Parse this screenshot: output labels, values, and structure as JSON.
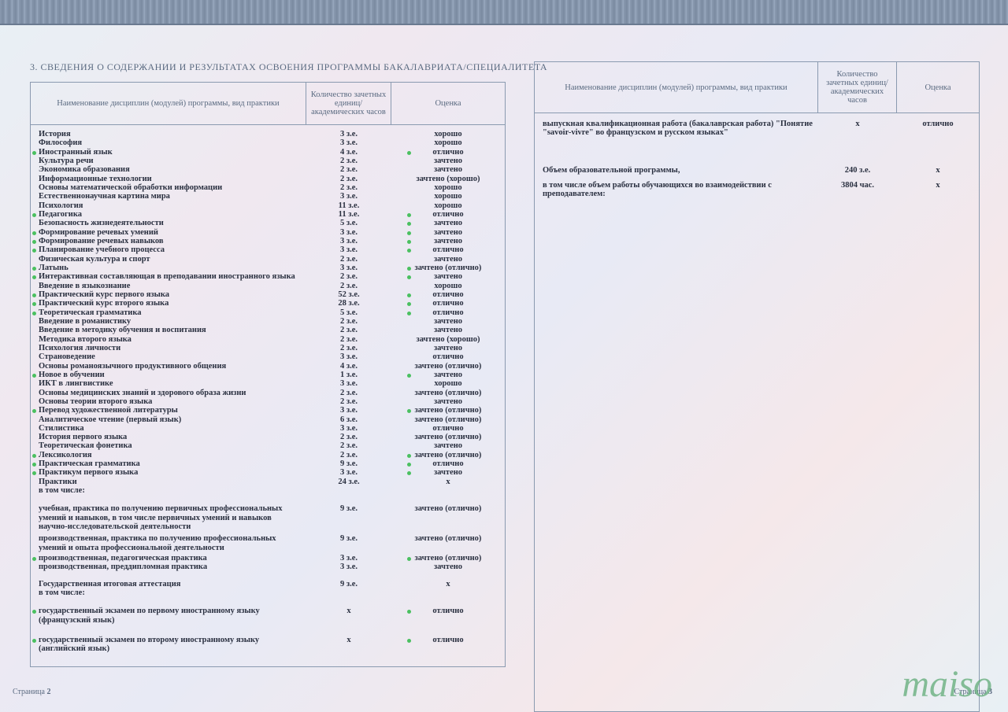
{
  "title": "3. СВЕДЕНИЯ О СОДЕРЖАНИИ И РЕЗУЛЬТАТАХ ОСВОЕНИЯ ПРОГРАММЫ БАКАЛАВРИАТА/СПЕЦИАЛИТЕТА",
  "headers": {
    "name": "Наименование дисциплин (модулей) программы, вид практики",
    "credits": "Количество зачетных единиц/ академических часов",
    "grade": "Оценка"
  },
  "left_rows": [
    {
      "name": "История",
      "credits": "3 з.е.",
      "grade": "хорошо",
      "dn": false,
      "dg": false
    },
    {
      "name": "Философия",
      "credits": "3 з.е.",
      "grade": "хорошо",
      "dn": false,
      "dg": false
    },
    {
      "name": "Иностранный язык",
      "credits": "4 з.е.",
      "grade": "отлично",
      "dn": true,
      "dg": true
    },
    {
      "name": "Культура речи",
      "credits": "2 з.е.",
      "grade": "зачтено",
      "dn": false,
      "dg": false
    },
    {
      "name": "Экономика образования",
      "credits": "2 з.е.",
      "grade": "зачтено",
      "dn": false,
      "dg": false
    },
    {
      "name": "Информационные технологии",
      "credits": "2 з.е.",
      "grade": "зачтено (хорошо)",
      "dn": false,
      "dg": false
    },
    {
      "name": "Основы математической обработки информации",
      "credits": "2 з.е.",
      "grade": "хорошо",
      "dn": false,
      "dg": false
    },
    {
      "name": "Естественнонаучная картина мира",
      "credits": "3 з.е.",
      "grade": "хорошо",
      "dn": false,
      "dg": false
    },
    {
      "name": "Психология",
      "credits": "11 з.е.",
      "grade": "хорошо",
      "dn": false,
      "dg": false
    },
    {
      "name": "Педагогика",
      "credits": "11 з.е.",
      "grade": "отлично",
      "dn": true,
      "dg": true
    },
    {
      "name": "Безопасность жизнедеятельности",
      "credits": "5 з.е.",
      "grade": "зачтено",
      "dn": false,
      "dg": true
    },
    {
      "name": "Формирование речевых умений",
      "credits": "3 з.е.",
      "grade": "зачтено",
      "dn": true,
      "dg": true
    },
    {
      "name": "Формирование речевых навыков",
      "credits": "3 з.е.",
      "grade": "зачтено",
      "dn": true,
      "dg": true
    },
    {
      "name": "Планирование учебного процесса",
      "credits": "3 з.е.",
      "grade": "отлично",
      "dn": true,
      "dg": true
    },
    {
      "name": "Физическая культура и спорт",
      "credits": "2 з.е.",
      "grade": "зачтено",
      "dn": false,
      "dg": false
    },
    {
      "name": "Латынь",
      "credits": "3 з.е.",
      "grade": "зачтено (отлично)",
      "dn": true,
      "dg": true
    },
    {
      "name": "Интерактивная составляющая в преподавании иностранного языка",
      "credits": "2 з.е.",
      "grade": "зачтено",
      "dn": true,
      "dg": true
    },
    {
      "name": "Введение в языкознание",
      "credits": "2 з.е.",
      "grade": "хорошо",
      "dn": false,
      "dg": false
    },
    {
      "name": "Практический курс первого языка",
      "credits": "52 з.е.",
      "grade": "отлично",
      "dn": true,
      "dg": true
    },
    {
      "name": "Практический курс второго языка",
      "credits": "28 з.е.",
      "grade": "отлично",
      "dn": true,
      "dg": true
    },
    {
      "name": "Теоретическая грамматика",
      "credits": "5 з.е.",
      "grade": "отлично",
      "dn": true,
      "dg": true
    },
    {
      "name": "Введение в романистику",
      "credits": "2 з.е.",
      "grade": "зачтено",
      "dn": false,
      "dg": false
    },
    {
      "name": "Введение в методику обучения и воспитания",
      "credits": "2 з.е.",
      "grade": "зачтено",
      "dn": false,
      "dg": false
    },
    {
      "name": "Методика второго языка",
      "credits": "2 з.е.",
      "grade": "зачтено (хорошо)",
      "dn": false,
      "dg": false
    },
    {
      "name": "Психология личности",
      "credits": "2 з.е.",
      "grade": "зачтено",
      "dn": false,
      "dg": false
    },
    {
      "name": "Страноведение",
      "credits": "3 з.е.",
      "grade": "отлично",
      "dn": false,
      "dg": false
    },
    {
      "name": "Основы романоязычного продуктивного общения",
      "credits": "4 з.е.",
      "grade": "зачтено (отлично)",
      "dn": false,
      "dg": false
    },
    {
      "name": "Новое в обучении",
      "credits": "1 з.е.",
      "grade": "зачтено",
      "dn": true,
      "dg": true
    },
    {
      "name": "ИКТ в лингвистике",
      "credits": "3 з.е.",
      "grade": "хорошо",
      "dn": false,
      "dg": false
    },
    {
      "name": "Основы медицинских знаний и здорового образа жизни",
      "credits": "2 з.е.",
      "grade": "зачтено (отлично)",
      "dn": false,
      "dg": false
    },
    {
      "name": "Основы теории второго языка",
      "credits": "2 з.е.",
      "grade": "зачтено",
      "dn": false,
      "dg": false
    },
    {
      "name": "Перевод художественной литературы",
      "credits": "3 з.е.",
      "grade": "зачтено (отлично)",
      "dn": true,
      "dg": true
    },
    {
      "name": "Аналитическое чтение (первый язык)",
      "credits": "6 з.е.",
      "grade": "зачтено (отлично)",
      "dn": false,
      "dg": false
    },
    {
      "name": "Стилистика",
      "credits": "3 з.е.",
      "grade": "отлично",
      "dn": false,
      "dg": false
    },
    {
      "name": "История первого языка",
      "credits": "2 з.е.",
      "grade": "зачтено (отлично)",
      "dn": false,
      "dg": false
    },
    {
      "name": "Теоретическая фонетика",
      "credits": "2 з.е.",
      "grade": "зачтено",
      "dn": false,
      "dg": false
    },
    {
      "name": "Лексикология",
      "credits": "2 з.е.",
      "grade": "зачтено (отлично)",
      "dn": true,
      "dg": true
    },
    {
      "name": "Практическая грамматика",
      "credits": "9 з.е.",
      "grade": "отлично",
      "dn": true,
      "dg": true
    },
    {
      "name": "Практикум первого языка",
      "credits": "3 з.е.",
      "grade": "зачтено",
      "dn": true,
      "dg": true
    },
    {
      "name": "Практики",
      "credits": "24 з.е.",
      "grade": "х",
      "dn": false,
      "dg": false
    },
    {
      "name": "в том числе:",
      "credits": "",
      "grade": "",
      "dn": false,
      "dg": false,
      "spacer_after": true
    },
    {
      "name": "учебная, практика по получению первичных профессиональных умений и навыков, в том числе первичных умений и навыков научно-исследовательской деятельности",
      "credits": "9 з.е.",
      "grade": "зачтено (отлично)",
      "dn": false,
      "dg": false,
      "multi": true
    },
    {
      "name": "производственная, практика по получению профессиональных умений и опыта профессиональной деятельности",
      "credits": "9 з.е.",
      "grade": "зачтено (отлично)",
      "dn": false,
      "dg": false,
      "multi": true
    },
    {
      "name": "производственная, педагогическая практика",
      "credits": "3 з.е.",
      "grade": "зачтено (отлично)",
      "dn": true,
      "dg": true
    },
    {
      "name": "производственная, преддипломная практика",
      "credits": "3 з.е.",
      "grade": "зачтено",
      "dn": false,
      "dg": false,
      "spacer_after": true
    },
    {
      "name": "Государственная итоговая аттестация",
      "credits": "9 з.е.",
      "grade": "х",
      "dn": false,
      "dg": false
    },
    {
      "name": "в том числе:",
      "credits": "",
      "grade": "",
      "dn": false,
      "dg": false,
      "spacer_after": true
    },
    {
      "name": "государственный экзамен по первому иностранному языку (французский язык)",
      "credits": "х",
      "grade": "отлично",
      "dn": true,
      "dg": true,
      "multi": true,
      "spacer_after": true
    },
    {
      "name": "государственный экзамен по второму иностранному языку (английский язык)",
      "credits": "х",
      "grade": "отлично",
      "dn": true,
      "dg": true,
      "multi": true
    }
  ],
  "right_rows": [
    {
      "name": "выпускная квалификационная работа (бакалаврская работа) \"Понятие \"savoir-vivre\" во французском и русском языках\"",
      "credits": "х",
      "grade": "отлично",
      "multi": true
    }
  ],
  "summary": {
    "line1": "Объем образовательной программы,",
    "line2": "в том числе объем работы обучающихся во взаимодействии с преподавателем:",
    "v1": "240 з.е.",
    "g1": "х",
    "v2": "3804 час.",
    "g2": "х"
  },
  "page_left_label": "Страница",
  "page_left_num": "2",
  "page_right_label": "Страница",
  "page_right_num": "3",
  "watermark": "maiso"
}
